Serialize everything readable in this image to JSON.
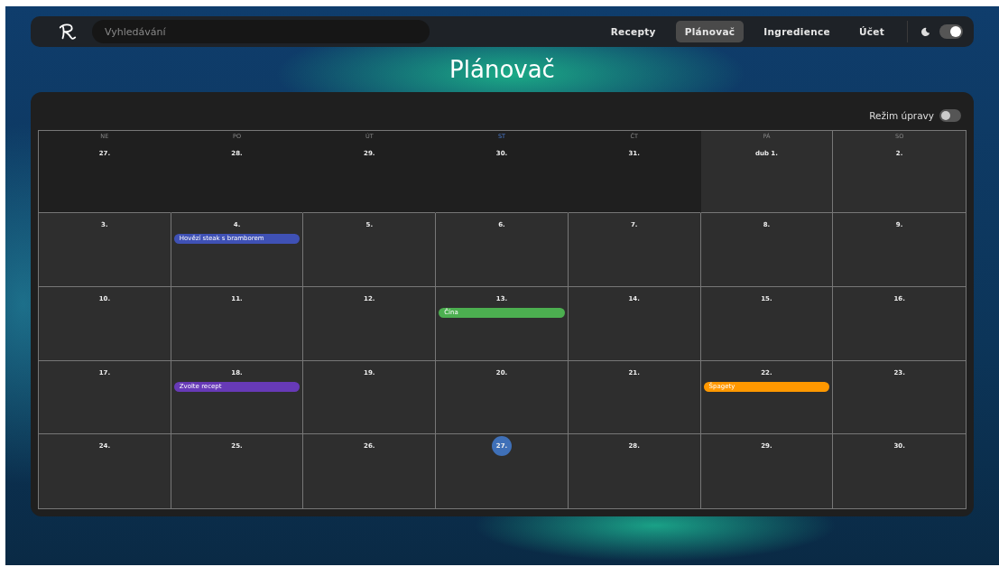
{
  "navbar": {
    "search": {
      "placeholder": "Vyhledávání"
    },
    "items": [
      {
        "label": "Recepty",
        "selected": false
      },
      {
        "label": "Plánovač",
        "selected": true
      },
      {
        "label": "Ingredience",
        "selected": false
      },
      {
        "label": "Účet",
        "selected": false
      }
    ],
    "dark_mode": {
      "on": true
    }
  },
  "page_title": "Plánovač",
  "edit_mode": {
    "label": "Režim úpravy",
    "on": false
  },
  "weekdays": [
    {
      "label": "NE",
      "selected": false
    },
    {
      "label": "PO",
      "selected": false
    },
    {
      "label": "ÚT",
      "selected": false
    },
    {
      "label": "ST",
      "selected": true
    },
    {
      "label": "ČT",
      "selected": false
    },
    {
      "label": "PÁ",
      "selected": false
    },
    {
      "label": "SO",
      "selected": false
    }
  ],
  "weeks": [
    [
      {
        "label": "27.",
        "outside": true,
        "today": false
      },
      {
        "label": "28.",
        "outside": true,
        "today": false
      },
      {
        "label": "29.",
        "outside": true,
        "today": false
      },
      {
        "label": "30.",
        "outside": true,
        "today": false
      },
      {
        "label": "31.",
        "outside": true,
        "today": false
      },
      {
        "label": "dub 1.",
        "outside": false,
        "today": false
      },
      {
        "label": "2.",
        "outside": false,
        "today": false
      }
    ],
    [
      {
        "label": "3.",
        "outside": false,
        "today": false
      },
      {
        "label": "4.",
        "outside": false,
        "today": false,
        "events": [
          {
            "title": "Hovězí steak s bramborem",
            "color": "#3f51b5"
          }
        ]
      },
      {
        "label": "5.",
        "outside": false,
        "today": false
      },
      {
        "label": "6.",
        "outside": false,
        "today": false
      },
      {
        "label": "7.",
        "outside": false,
        "today": false
      },
      {
        "label": "8.",
        "outside": false,
        "today": false
      },
      {
        "label": "9.",
        "outside": false,
        "today": false
      }
    ],
    [
      {
        "label": "10.",
        "outside": false,
        "today": false
      },
      {
        "label": "11.",
        "outside": false,
        "today": false
      },
      {
        "label": "12.",
        "outside": false,
        "today": false
      },
      {
        "label": "13.",
        "outside": false,
        "today": false,
        "events": [
          {
            "title": "Čína",
            "color": "#4caf50"
          }
        ]
      },
      {
        "label": "14.",
        "outside": false,
        "today": false
      },
      {
        "label": "15.",
        "outside": false,
        "today": false
      },
      {
        "label": "16.",
        "outside": false,
        "today": false
      }
    ],
    [
      {
        "label": "17.",
        "outside": false,
        "today": false
      },
      {
        "label": "18.",
        "outside": false,
        "today": false,
        "events": [
          {
            "title": "Zvolte recept",
            "color": "#673ab7"
          }
        ]
      },
      {
        "label": "19.",
        "outside": false,
        "today": false
      },
      {
        "label": "20.",
        "outside": false,
        "today": false
      },
      {
        "label": "21.",
        "outside": false,
        "today": false
      },
      {
        "label": "22.",
        "outside": false,
        "today": false,
        "events": [
          {
            "title": "Špagety",
            "color": "#ff9800"
          }
        ]
      },
      {
        "label": "23.",
        "outside": false,
        "today": false
      }
    ],
    [
      {
        "label": "24.",
        "outside": false,
        "today": false
      },
      {
        "label": "25.",
        "outside": false,
        "today": false
      },
      {
        "label": "26.",
        "outside": false,
        "today": false
      },
      {
        "label": "27.",
        "outside": false,
        "today": true
      },
      {
        "label": "28.",
        "outside": false,
        "today": false
      },
      {
        "label": "29.",
        "outside": false,
        "today": false
      },
      {
        "label": "30.",
        "outside": false,
        "today": false
      }
    ]
  ]
}
